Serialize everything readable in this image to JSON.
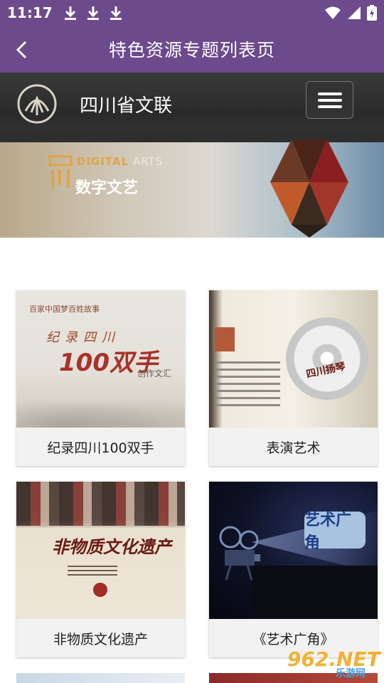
{
  "status_bar": {
    "time": "11:17",
    "icons": [
      "download-icon",
      "download-icon",
      "download-icon",
      "wifi-icon",
      "cell-signal-icon",
      "battery-charging-icon"
    ]
  },
  "app_bar": {
    "title": "特色资源专题列表页"
  },
  "brand": {
    "name": "四川省文联"
  },
  "banner": {
    "en_prefix": "DIGITAL",
    "en_suffix": " ARTS",
    "cn_title": "数字文艺"
  },
  "cards": [
    {
      "caption": "纪录四川100双手",
      "image_text": {
        "top": "百家中国梦百姓故事",
        "line1": "纪录四川",
        "line2": "100双手",
        "line3": "创作文汇"
      }
    },
    {
      "caption": "表演艺术",
      "image_text": {
        "disc": "四川扬琴"
      }
    },
    {
      "caption": "非物质文化遗产",
      "image_text": {
        "title": "非物质文化遗产"
      }
    },
    {
      "caption": "《艺术广角》",
      "image_text": {
        "sign": "艺术广角"
      }
    }
  ],
  "watermark": {
    "brand": "962.NET",
    "site": "乐游网"
  },
  "colors": {
    "accent": "#6c4a8c",
    "brand_bar": "#2f2f2f",
    "caption_bg": "#f2f2f2"
  }
}
